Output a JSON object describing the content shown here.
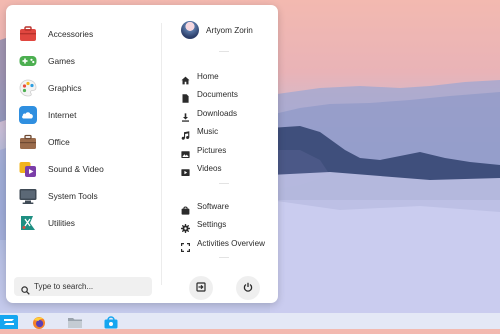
{
  "user": {
    "name": "Artyom Zorin"
  },
  "categories": [
    {
      "label": "Accessories",
      "icon": "accessories-icon",
      "color": "#e0463f"
    },
    {
      "label": "Games",
      "icon": "games-icon",
      "color": "#4caf50"
    },
    {
      "label": "Graphics",
      "icon": "graphics-icon",
      "color": "#f2f2f2"
    },
    {
      "label": "Internet",
      "icon": "internet-icon",
      "color": "#2f8fe0"
    },
    {
      "label": "Office",
      "icon": "office-icon",
      "color": "#9a6b4b"
    },
    {
      "label": "Sound & Video",
      "icon": "sound-video-icon",
      "color": "#f0b41c"
    },
    {
      "label": "System Tools",
      "icon": "system-tools-icon",
      "color": "#3f4a55"
    },
    {
      "label": "Utilities",
      "icon": "utilities-icon",
      "color": "#1e8f82"
    }
  ],
  "places": [
    {
      "label": "Home",
      "icon": "home-icon"
    },
    {
      "label": "Documents",
      "icon": "document-icon"
    },
    {
      "label": "Downloads",
      "icon": "download-icon"
    },
    {
      "label": "Music",
      "icon": "music-icon"
    },
    {
      "label": "Pictures",
      "icon": "picture-icon"
    },
    {
      "label": "Videos",
      "icon": "video-icon"
    }
  ],
  "system": [
    {
      "label": "Software",
      "icon": "software-icon"
    },
    {
      "label": "Settings",
      "icon": "settings-icon"
    },
    {
      "label": "Activities Overview",
      "icon": "activities-overview-icon"
    }
  ],
  "search": {
    "placeholder": "Type to search..."
  },
  "power": {
    "logout_icon": "logout-icon",
    "power_icon": "power-icon"
  },
  "taskbar": {
    "items": [
      "zorin-menu-icon",
      "firefox-icon",
      "files-icon",
      "software-store-icon"
    ],
    "accent": "#15a6f0"
  }
}
